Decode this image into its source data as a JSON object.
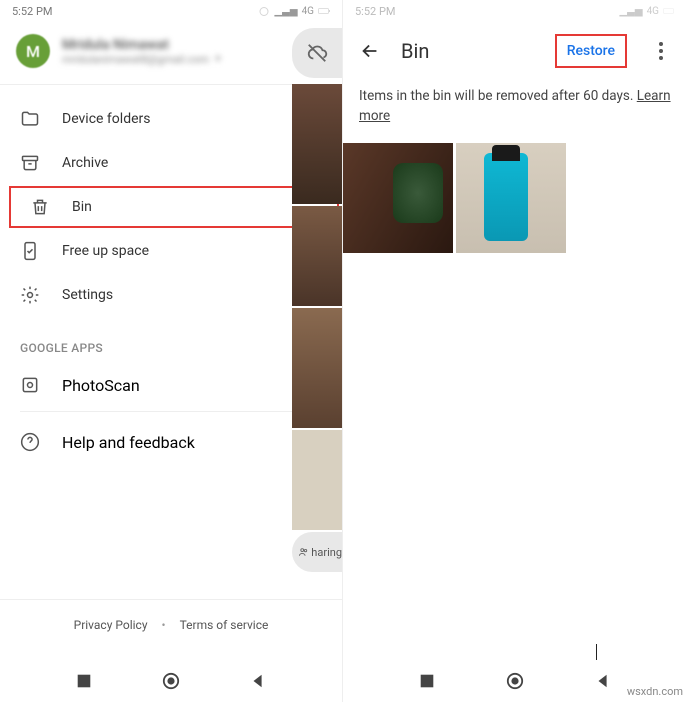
{
  "status": {
    "time": "5:52 PM",
    "network": "4G"
  },
  "profile": {
    "initial": "M",
    "name": "Mridula Nimawat",
    "email": "mridulanimawat8@gmail.com"
  },
  "menu": {
    "device_folders": "Device folders",
    "archive": "Archive",
    "bin": "Bin",
    "free_up": "Free up space",
    "settings": "Settings"
  },
  "section_apps": "GOOGLE APPS",
  "apps": {
    "photoscan": "PhotoScan"
  },
  "help": "Help and feedback",
  "footer": {
    "privacy": "Privacy Policy",
    "dot": "•",
    "terms": "Terms of service"
  },
  "bg": {
    "sharing": "haring"
  },
  "bin": {
    "title": "Bin",
    "restore": "Restore",
    "message": "Items in the bin will be removed after 60 days. ",
    "learn_more": "Learn more"
  },
  "watermark": "wsxdn.com"
}
